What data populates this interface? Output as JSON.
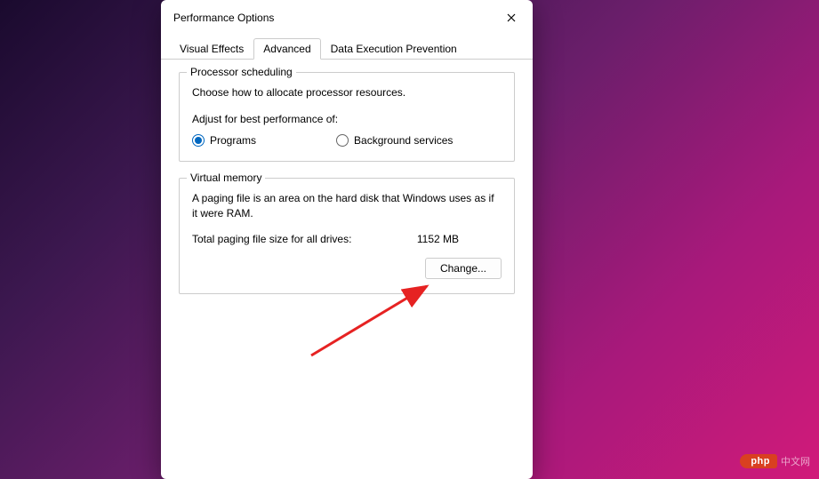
{
  "title": "Performance Options",
  "tabs": {
    "visual": "Visual Effects",
    "advanced": "Advanced",
    "dep": "Data Execution Prevention"
  },
  "processor": {
    "legend": "Processor scheduling",
    "desc": "Choose how to allocate processor resources.",
    "adjust_label": "Adjust for best performance of:",
    "programs": "Programs",
    "background": "Background services"
  },
  "vm": {
    "legend": "Virtual memory",
    "desc": "A paging file is an area on the hard disk that Windows uses as if it were RAM.",
    "total_label": "Total paging file size for all drives:",
    "total_value": "1152 MB",
    "change_button": "Change..."
  },
  "watermark": {
    "badge": "php",
    "text": "中文网"
  }
}
